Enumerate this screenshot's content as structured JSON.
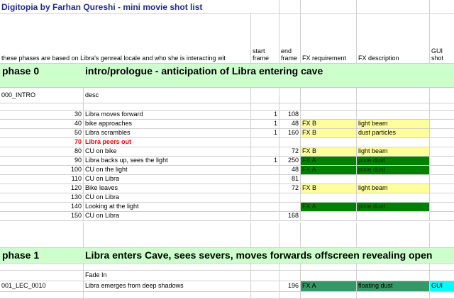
{
  "title": "Digitopia by Farhan Qureshi - mini movie shot list",
  "headers": {
    "note": "these phases are based on Libra's genreal locale and who she is interacting wit",
    "start_frame": "start frame",
    "end_frame": "end frame",
    "fx_requirement": "FX requirement",
    "fx_description": "FX description",
    "gui_shot": "GUI shot"
  },
  "phase0": {
    "label": "phase 0",
    "description": "intro/prologue - anticipation of Libra entering cave",
    "shot_id": "000_INTRO",
    "desc_label": "desc",
    "rows": [
      {
        "num": "30",
        "text": "Libra moves forward",
        "start": "1",
        "end": "108",
        "fx": "",
        "fxdesc": ""
      },
      {
        "num": "40",
        "text": "bike approaches",
        "start": "1",
        "end": "48",
        "fx": "FX B",
        "fxdesc": "light beam"
      },
      {
        "num": "50",
        "text": "Libra scrambles",
        "start": "1",
        "end": "160",
        "fx": "FX B",
        "fxdesc": "dust particles"
      },
      {
        "num": "70",
        "text": "Libra peers out",
        "start": "",
        "end": "",
        "fx": "",
        "fxdesc": ""
      },
      {
        "num": "80",
        "text": "CU on bike",
        "start": "",
        "end": "72",
        "fx": "FX B",
        "fxdesc": "light beam"
      },
      {
        "num": "90",
        "text": "Libra backs up, sees the light",
        "start": "1",
        "end": "250",
        "fx": "FX A",
        "fxdesc": "pixie dust"
      },
      {
        "num": "100",
        "text": "CU on the light",
        "start": "",
        "end": "48",
        "fx": "FX A",
        "fxdesc": "pixie dust"
      },
      {
        "num": "110",
        "text": "CU on Libra",
        "start": "",
        "end": "81",
        "fx": "",
        "fxdesc": ""
      },
      {
        "num": "120",
        "text": "Bike leaves",
        "start": "",
        "end": "72",
        "fx": "FX B",
        "fxdesc": "light beam"
      },
      {
        "num": "130",
        "text": "CU on Libra",
        "start": "",
        "end": "",
        "fx": "",
        "fxdesc": ""
      },
      {
        "num": "140",
        "text": "Looking at the light",
        "start": "",
        "end": "",
        "fx": "FX A",
        "fxdesc": "pixie dust"
      },
      {
        "num": "150",
        "text": "CU on Libra",
        "start": "",
        "end": "168",
        "fx": "",
        "fxdesc": ""
      }
    ]
  },
  "phase1": {
    "label": "phase 1",
    "description": "Libra enters Cave, sees severs, moves forwards offscreen revealing open",
    "fade_in": "Fade In",
    "shot_id": "001_LEC_0010",
    "shot_text": "Libra emerges from deep shadows",
    "shot_end": "196",
    "shot_fx": "FX A",
    "shot_fxdesc": "floating dust",
    "shot_gui": "GUI"
  },
  "colors": {
    "fx_b": "#ffff99",
    "fx_a": "#008000",
    "fx_a_alt": "#339966",
    "gui": "#00ffff",
    "phase_band": "#ccffcc",
    "title": "#1f2d8a",
    "highlight_text": "#ff0000"
  }
}
